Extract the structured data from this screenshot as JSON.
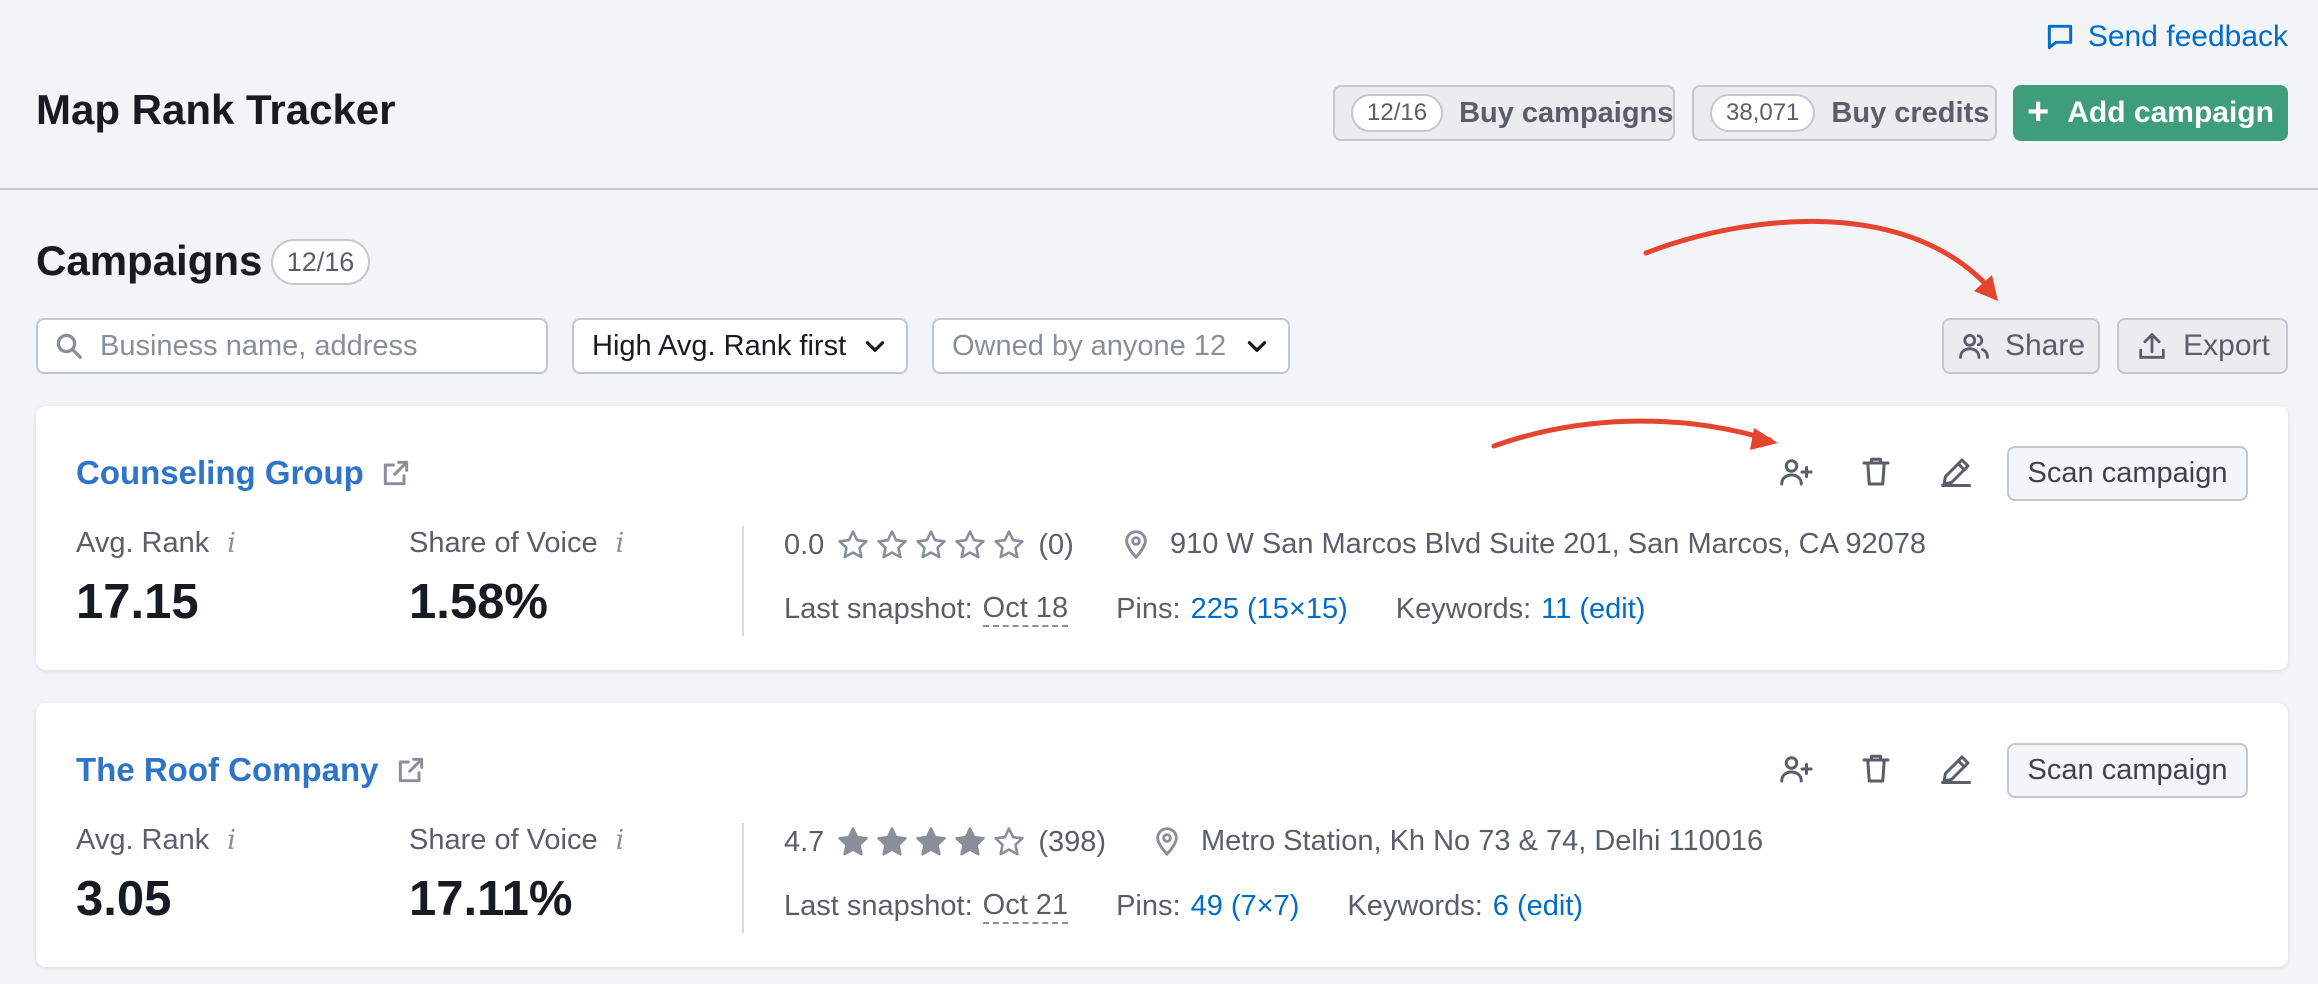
{
  "header": {
    "feedback_label": "Send feedback",
    "title": "Map Rank Tracker",
    "buy_campaigns": {
      "count": "12/16",
      "label": "Buy campaigns"
    },
    "buy_credits": {
      "count": "38,071",
      "label": "Buy credits"
    },
    "add_campaign_label": "Add campaign"
  },
  "campaigns": {
    "title": "Campaigns",
    "count": "12/16"
  },
  "filters": {
    "search_placeholder": "Business name, address",
    "search_value": "",
    "sort_selected": "High Avg. Rank first",
    "owner_selected": "Owned by anyone 12",
    "share_label": "Share",
    "export_label": "Export"
  },
  "cards": [
    {
      "name": "Counseling Group",
      "avg_rank_label": "Avg. Rank",
      "avg_rank": "17.15",
      "sov_label": "Share of Voice",
      "sov": "1.58%",
      "info_glyph": "i",
      "rating": "0.0",
      "rating_stars": 0,
      "reviews": "(0)",
      "address": "910 W San Marcos Blvd Suite 201, San Marcos, CA 92078",
      "snapshot_label": "Last snapshot:",
      "snapshot_date": "Oct 18",
      "pins_label": "Pins:",
      "pins_value": "225 (15×15)",
      "keywords_label": "Keywords:",
      "keywords_value": "11 (edit)",
      "scan_label": "Scan campaign"
    },
    {
      "name": "The Roof Company",
      "avg_rank_label": "Avg. Rank",
      "avg_rank": "3.05",
      "sov_label": "Share of Voice",
      "sov": "17.11%",
      "info_glyph": "i",
      "rating": "4.7",
      "rating_stars": 4,
      "reviews": "(398)",
      "address": "Metro Station, Kh No 73 & 74, Delhi 110016",
      "snapshot_label": "Last snapshot:",
      "snapshot_date": "Oct 21",
      "pins_label": "Pins:",
      "pins_value": "49 (7×7)",
      "keywords_label": "Keywords:",
      "keywords_value": "6 (edit)",
      "scan_label": "Scan campaign"
    }
  ],
  "icons": {
    "feedback": "speech-bubble-icon",
    "search": "magnifier-icon",
    "chevron": "chevron-down-icon",
    "share": "users-icon",
    "export": "upload-icon",
    "external": "external-link-icon",
    "add_user": "add-user-icon",
    "delete": "trash-icon",
    "edit": "pencil-icon",
    "location": "location-pin-icon",
    "star": "star-icon",
    "plus": "+"
  },
  "colors": {
    "accent_link": "#006dca",
    "campaign_link": "#2e74c9",
    "primary_button": "#3e9e7b",
    "annotation_arrow": "#e5452f",
    "star_filled": "#8a8e9b"
  }
}
